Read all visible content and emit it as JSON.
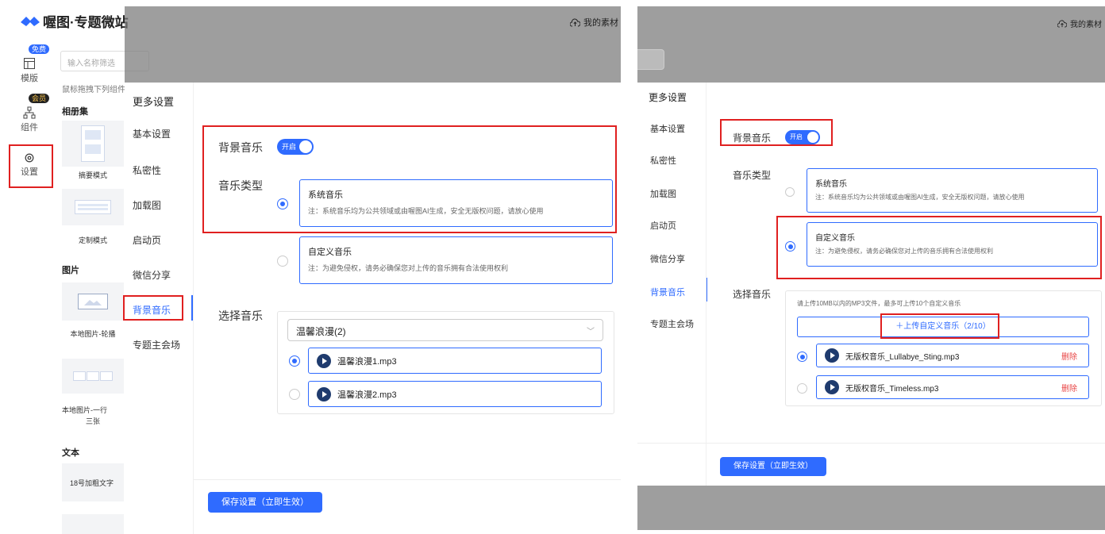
{
  "app": {
    "logo_text": "喔图·专题微站",
    "brand_color": "#2f6bff",
    "alert_color": "#e02020"
  },
  "rail": {
    "free_badge": "免费",
    "member_badge": "会员",
    "items": [
      {
        "label": "模版",
        "icon": "template-icon"
      },
      {
        "label": "组件",
        "icon": "component-icon"
      },
      {
        "label": "设置",
        "icon": "settings-icon"
      }
    ]
  },
  "library": {
    "search_placeholder": "输入名称筛选",
    "hint": "鼠标拖拽下列组件",
    "sections": {
      "album": "相册集",
      "pictures": "图片",
      "text": "文本"
    },
    "thumbs": {
      "abstract_mode": "摘要模式",
      "custom_mode": "定制模式",
      "local_carousel": "本地图片-轮播",
      "local_row1": "本地图片-一行",
      "local_row2": "三张",
      "bold_text": "18号加粗文字"
    }
  },
  "topbar": {
    "my_assets": "我的素材"
  },
  "modal1": {
    "title": "更多设置",
    "nav": [
      "基本设置",
      "私密性",
      "加载图",
      "启动页",
      "微信分享",
      "背景音乐",
      "专题主会场"
    ],
    "bg_music_label": "背景音乐",
    "toggle_on": "开启",
    "music_type_label": "音乐类型",
    "system_music": {
      "title": "系统音乐",
      "desc": "注：系统音乐均为公共领域或由喔图AI生成，安全无版权问题，请放心使用"
    },
    "custom_music": {
      "title": "自定义音乐",
      "desc": "注：为避免侵权，请务必确保您对上传的音乐拥有合法使用权利"
    },
    "select_music_label": "选择音乐",
    "playlist_selected": "温馨浪漫(2)",
    "tracks": [
      "温馨浪漫1.mp3",
      "温馨浪漫2.mp3"
    ],
    "save_button": "保存设置（立即生效）"
  },
  "modal2": {
    "topbar_link": "我的素材",
    "title": "更多设置",
    "nav": [
      "基本设置",
      "私密性",
      "加载图",
      "启动页",
      "微信分享",
      "背景音乐",
      "专题主会场"
    ],
    "bg_music_label": "背景音乐",
    "toggle_on": "开启",
    "music_type_label": "音乐类型",
    "system_music": {
      "title": "系统音乐",
      "desc": "注：系统音乐均为公共领域或由喔图AI生成，安全无版权问题，请放心使用"
    },
    "custom_music": {
      "title": "自定义音乐",
      "desc": "注：为避免侵权，请务必确保您对上传的音乐拥有合法使用权利"
    },
    "select_music_label": "选择音乐",
    "upload_hint": "请上传10MB以内的MP3文件，最多可上传10个自定义音乐",
    "upload_button": "＋上传自定义音乐（2/10）",
    "tracks": [
      "无版权音乐_Lullabye_Sting.mp3",
      "无版权音乐_Timeless.mp3"
    ],
    "delete_label": "删除",
    "save_button": "保存设置（立即生效）"
  }
}
